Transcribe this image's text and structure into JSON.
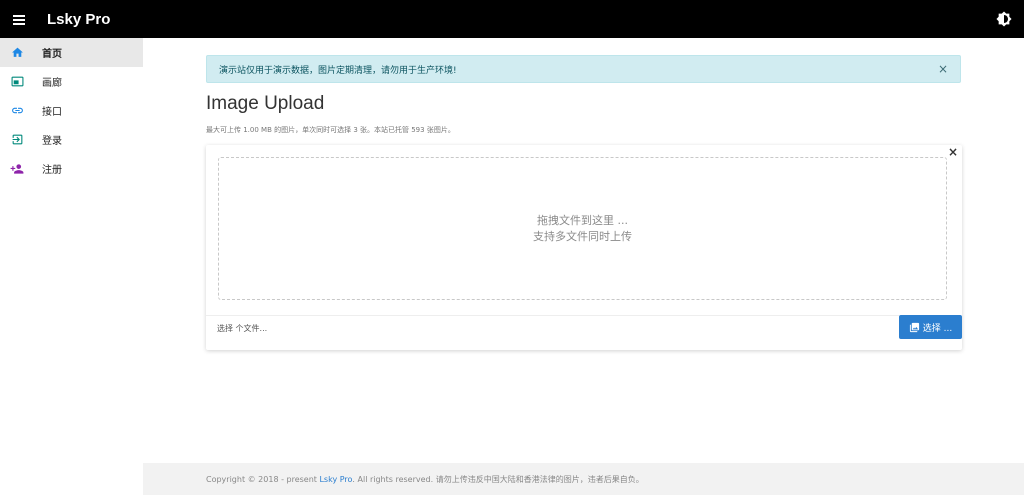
{
  "header": {
    "brand": "Lsky Pro",
    "menu_icon": "hamburger-menu-icon",
    "theme_icon": "brightness-icon"
  },
  "sidebar": {
    "items": [
      {
        "label": "首页",
        "icon": "home-icon",
        "color": "#1e88e5",
        "active": true
      },
      {
        "label": "画廊",
        "icon": "gallery-icon",
        "color": "#00897b",
        "active": false
      },
      {
        "label": "接口",
        "icon": "link-icon",
        "color": "#1e88e5",
        "active": false
      },
      {
        "label": "登录",
        "icon": "login-icon",
        "color": "#00897b",
        "active": false
      },
      {
        "label": "注册",
        "icon": "add-user-icon",
        "color": "#8e24aa",
        "active": false
      }
    ]
  },
  "alert": {
    "text": "演示站仅用于演示数据，图片定期清理，请勿用于生产环境!",
    "close": "×"
  },
  "main": {
    "title": "Image Upload",
    "subtitle": "最大可上传 1.00 MB 的图片，单次同时可选择 3 张。本站已托管 593 张图片。"
  },
  "upload": {
    "close": "×",
    "drop_line1": "拖拽文件到这里 ...",
    "drop_line2": "支持多文件同时上传",
    "file_placeholder": "选择 个文件...",
    "browse_label": "选择 ..."
  },
  "footer": {
    "copyright_prefix": "Copyright © 2018 - present",
    "brand_link": "Lsky Pro",
    "copyright_suffix": ". All rights reserved. 请勿上传违反中国大陆和香港法律的图片，违者后果自负。"
  },
  "colors": {
    "topbar": "#000000",
    "accent": "#2b7ecf",
    "alert_bg": "#d1ecf1"
  }
}
